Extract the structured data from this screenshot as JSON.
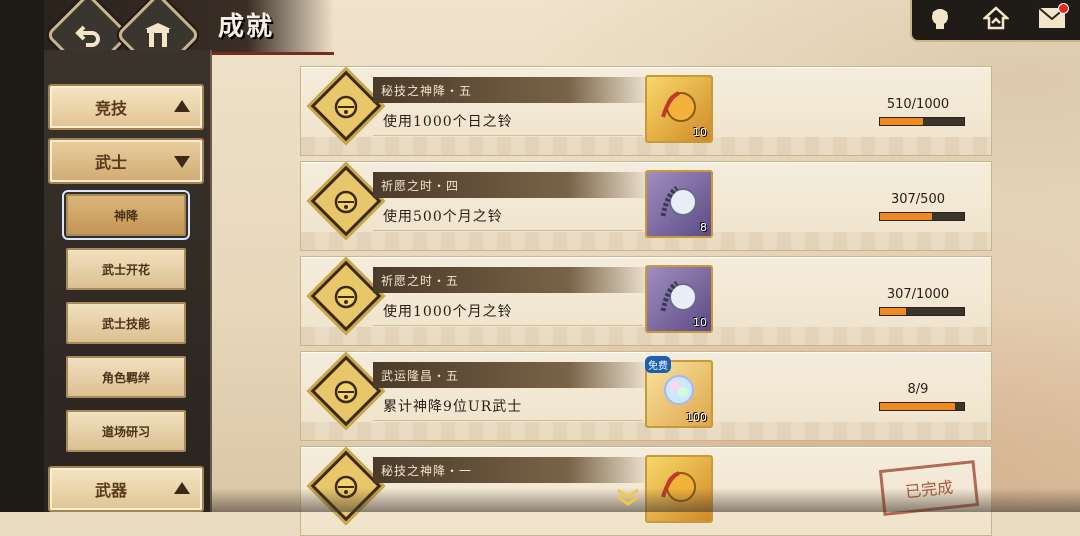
{
  "header": {
    "title": "成就"
  },
  "sidebar": {
    "categories": [
      {
        "label": "竞技",
        "state": "collapsed"
      },
      {
        "label": "武士",
        "state": "expanded"
      },
      {
        "label": "武器",
        "state": "collapsed"
      }
    ],
    "subitems": [
      {
        "label": "神降",
        "active": true
      },
      {
        "label": "武士开花",
        "active": false
      },
      {
        "label": "武士技能",
        "active": false
      },
      {
        "label": "角色羁绊",
        "active": false
      },
      {
        "label": "道场研习",
        "active": false
      }
    ]
  },
  "achievements": [
    {
      "name": "秘技之神降・五",
      "desc": "使用1000个日之铃",
      "item_count": "10",
      "item_icon": "sun-bell-icon",
      "progress_text": "510/1000",
      "progress": 0.51
    },
    {
      "name": "祈愿之时・四",
      "desc": "使用500个月之铃",
      "item_count": "8",
      "item_icon": "moon-bell-icon",
      "progress_text": "307/500",
      "progress": 0.614
    },
    {
      "name": "祈愿之时・五",
      "desc": "使用1000个月之铃",
      "item_count": "10",
      "item_icon": "moon-bell-icon",
      "progress_text": "307/1000",
      "progress": 0.307
    },
    {
      "name": "武运隆昌・五",
      "desc": "累计神降9位UR武士",
      "item_count": "100",
      "item_icon": "crystal-icon",
      "item_tag": "免费",
      "progress_text": "8/9",
      "progress": 0.889
    },
    {
      "name": "秘技之神降・一",
      "desc": "",
      "item_count": "",
      "item_icon": "sun-bell-icon",
      "stamp": "已完成"
    }
  ],
  "colors": {
    "progress_fill": "#ef8a1c",
    "accent_red": "#7a2b1f"
  }
}
